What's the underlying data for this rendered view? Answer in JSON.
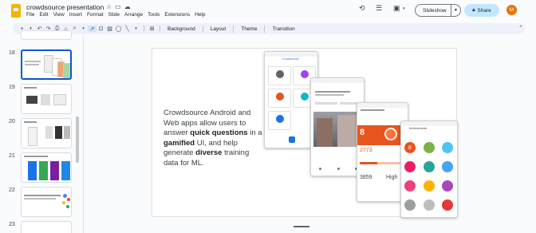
{
  "header": {
    "title": "crowdsource presentation",
    "menu": [
      "File",
      "Edit",
      "View",
      "Insert",
      "Format",
      "Slide",
      "Arrange",
      "Tools",
      "Extensions",
      "Help"
    ],
    "slideshow_label": "Slideshow",
    "share_label": "Share",
    "avatar_initial": "M"
  },
  "toolbar": {
    "background_label": "Background",
    "layout_label": "Layout",
    "theme_label": "Theme",
    "transition_label": "Transition"
  },
  "filmstrip": {
    "slide_numbers": [
      "18",
      "19",
      "20",
      "21",
      "22",
      "23"
    ]
  },
  "slide": {
    "text_1": "Crowdsource Android and Web apps allow users to answer ",
    "bold_1": "quick questions",
    "text_2": " in a ",
    "bold_2": "gamified",
    "text_3": " UI, and help generate ",
    "bold_3": "diverse",
    "text_4": " training data for ML.",
    "phone1_title": "Crowdsource",
    "phone3_value_1": "8",
    "phone3_value_2": "2773",
    "phone3_value_3": "3859",
    "phone3_value_4": "High",
    "phone4_title": "Achievements",
    "phone4_value": "8"
  },
  "colors": {
    "accent": "#0b57d0",
    "share_bg": "#c2e7ff",
    "avatar_bg": "#e8710a",
    "logo": "#f4b400",
    "orange_card": "#e8541e"
  }
}
